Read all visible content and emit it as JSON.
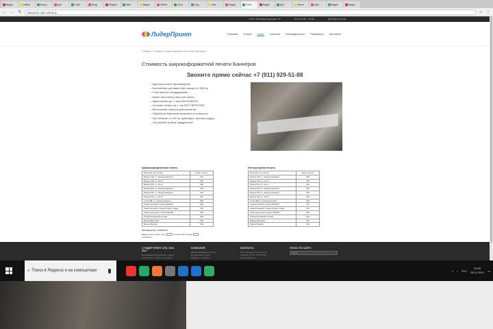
{
  "browser": {
    "tabs": [
      {
        "label": "Видео",
        "color": "#d33"
      },
      {
        "label": "Найти",
        "color": "#fc3"
      },
      {
        "label": "Класс",
        "color": "#39c"
      },
      {
        "label": "Доп",
        "color": "#e55"
      },
      {
        "label": "Сайт",
        "color": "#3a3"
      },
      {
        "label": "Вход",
        "color": "#e55"
      },
      {
        "label": "Яндекс",
        "color": "#d33"
      },
      {
        "label": "Mail",
        "color": "#39c"
      },
      {
        "label": "Видео",
        "color": "#fc3"
      },
      {
        "label": "Найти",
        "color": "#e55"
      },
      {
        "label": "uCoz",
        "color": "#3a3"
      },
      {
        "label": "Под",
        "color": "#39c"
      },
      {
        "label": "Нов",
        "color": "#fc3"
      },
      {
        "label": "Лидер",
        "color": "#e55"
      },
      {
        "label": "Стоп",
        "color": "#39c",
        "active": true
      },
      {
        "label": "Видео",
        "color": "#d33"
      },
      {
        "label": "Доб",
        "color": "#3a3"
      },
      {
        "label": "Лента",
        "color": "#fc3"
      },
      {
        "label": "Qiwi",
        "color": "#e55"
      },
      {
        "label": "Видео",
        "color": "#39c"
      },
      {
        "label": "Видео",
        "color": "#d33"
      }
    ],
    "url": "liderprint.spb.ru/tseny"
  },
  "site": {
    "topbar": [
      "СПб, Литейный проспект 26",
      "Пн-Пт 9:00 - 19:00",
      "8(812)929-51-88"
    ],
    "logo_text": "ЛидерПринт",
    "menu": [
      {
        "label": "Главная"
      },
      {
        "label": "Услуги"
      },
      {
        "label": "Цены",
        "current": true
      },
      {
        "label": "Галерея"
      },
      {
        "label": "Благодарности"
      },
      {
        "label": "Реквизиты"
      },
      {
        "label": "Контакты"
      }
    ],
    "breadcrumbs": "Главная / Стоимость широкоформатной печати баннеров",
    "title": "Стоимость широкоформатной печати Баннеров",
    "phone": "Звоните прямо сейчас +7 (911) 929-51-88",
    "features": [
      "Круглосуточное производство",
      "Бесплатная доставка (при заказе от 3000 р)",
      "Собственное оборудование",
      "Макет бесплатно (простой текст)",
      "Цветопробы до 1 часа БЕСПЛАТНО",
      "Срочная печать за 1 час БЕЗ ПЕРЕПЛАТ",
      "Бесплатная порезка для клиентов",
      "Обработка баннеров включена в стоимость",
      "При объеме от 100 кв. действует система скидок",
      "220 рублей за метр квадратный"
    ]
  },
  "tables": {
    "left": {
      "title": "Широкоформатная печать",
      "head": [
        "Материал для печати",
        "Цена, за кв.м."
      ],
      "rows": [
        [
          "Баннер 440 гр. ламинированный",
          "220"
        ],
        [
          "Баннер 440 гр. литой",
          "250"
        ],
        [
          "Баннер 510 гр. литой",
          "280"
        ],
        [
          "Баннер 510 гр. ламинированный",
          "250"
        ],
        [
          "Баннер 610 гр. ламинированный",
          "300"
        ],
        [
          "Баннер 610 гр. литой",
          "330"
        ],
        [
          "Сетка 380 гр. самоклеющаяся",
          "280"
        ],
        [
          "Самоклеящаяся плёнка ORAJET",
          "280"
        ],
        [
          "Самоклеящаяся плёнка Oracal / Orajet",
          "330"
        ],
        [
          "Транслюцентная пленка ORAJET",
          "480"
        ],
        [
          "Перфорированная плёнка",
          "480"
        ],
        [
          "Бумага Blue back",
          "150"
        ],
        [
          "Бумага Bluebac",
          "150"
        ]
      ]
    },
    "right": {
      "title": "Интерьерная печать",
      "head": [
        "Материал для печати",
        "Цена, за кв.м."
      ],
      "rows": [
        [
          "Баннер 440 гр. ламинированный",
          "380"
        ],
        [
          "Баннер 440 гр. литой",
          "400"
        ],
        [
          "Баннер 510 гр. литой",
          "420"
        ],
        [
          "Баннер 510 гр. ламинированный",
          "400"
        ],
        [
          "Баннер 610 гр. ламинированный",
          "430"
        ],
        [
          "Баннер 610 гр. литой",
          "450"
        ],
        [
          "Сетка 380 гр. самоклеющаяся",
          "420"
        ],
        [
          "Самоклеящаяся плёнка ORAJET",
          "470"
        ],
        [
          "Самоклеящаяся плёнка Oracal / Orajet",
          "470"
        ],
        [
          "Транслюцентная пленка ORAJET",
          "500"
        ],
        [
          "Перфорированная плёнка",
          "500"
        ],
        [
          "Бумага Blue back",
          "320"
        ],
        [
          "Бумага Bluebac",
          "320"
        ]
      ]
    }
  },
  "calculator": {
    "title": "Калькулятор стоимости",
    "row1_prefix": "Введите цену за кв. метр",
    "row1_mid": "и количество метров",
    "row2": "Стоимость:"
  },
  "footer": {
    "cols": [
      {
        "title": "О ЛИДЕР ПРИНТ СПб, 2016-2017",
        "lines": [
          "Копирование материалов с сайта",
          "допускается только со ссылкой"
        ]
      },
      {
        "title": "КОМПАНИЯ",
        "lines": [
          "Широкоформатная печать",
          "Интерьерная печать",
          "Баннеры и плакаты"
        ]
      },
      {
        "title": "КОНТАКТЫ",
        "lines": [
          "СПб, Литейный проспект 26",
          "Телефон: Пн-Пт 9:00-19:00",
          "liderprint@mail.ru"
        ]
      }
    ],
    "search_title": "ПОИСК ПО САЙТУ",
    "search_placeholder": "Поиск..."
  },
  "taskbar": {
    "search_text": "Поиск в Яндексе и на компьютере",
    "apps": [
      {
        "color": "#e33"
      },
      {
        "color": "#2a6"
      },
      {
        "color": "#e73"
      },
      {
        "color": "#777"
      },
      {
        "color": "#1e73c8"
      },
      {
        "color": "#1e73c8"
      },
      {
        "color": "#3a6"
      }
    ],
    "lang": "РУС",
    "time": "23:09",
    "date": "05.12.2017"
  }
}
